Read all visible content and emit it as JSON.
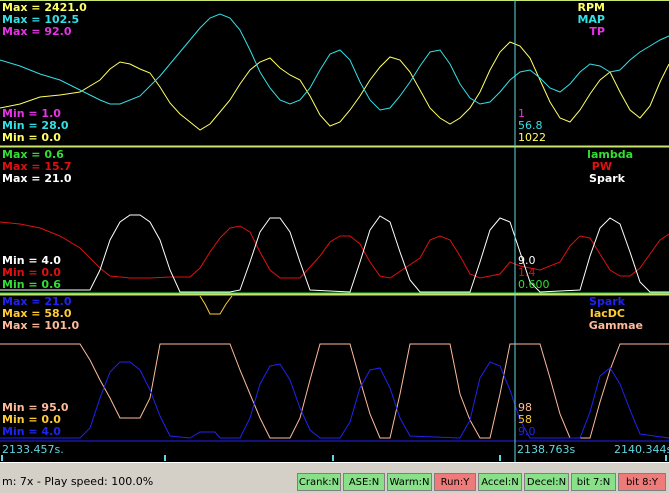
{
  "colors": {
    "rpm": "#ffff66",
    "map": "#33e0e6",
    "tp": "#e633e6",
    "lambda": "#33dd33",
    "pw": "#dd1111",
    "spark": "#ffffff",
    "spark3": "#2222ee",
    "iacdc": "#ffcc33",
    "gammae": "#ffbb99",
    "divider": "#c8e66e",
    "cursor": "#5fd7e0",
    "flag_on": "#88e088",
    "flag_off": "#ee7a7a"
  },
  "panel1": {
    "max_labels": [
      "Max = 2421.0",
      "Max = 102.5",
      "Max = 92.0"
    ],
    "min_labels": [
      "Min = 1.0",
      "Min = 28.0",
      "Min = 0.0"
    ],
    "names": [
      "RPM",
      "MAP",
      "TP"
    ],
    "cursor_values": [
      "1",
      "56.8",
      "1022"
    ]
  },
  "panel2": {
    "max_labels": [
      "Max = 0.6",
      "Max = 15.7",
      "Max = 21.0"
    ],
    "min_labels": [
      "Min = 4.0",
      "Min = 0.0",
      "Min = 0.6"
    ],
    "names": [
      "lambda",
      "PW",
      "Spark"
    ],
    "cursor_values": [
      "9.0",
      "1.4",
      "0.600"
    ]
  },
  "panel3": {
    "max_labels": [
      "Max = 21.0",
      "Max = 58.0",
      "Max = 101.0"
    ],
    "min_labels": [
      "Min = 95.0",
      "Min = 0.0",
      "Min = 4.0"
    ],
    "names": [
      "Spark",
      "IacDC",
      "Gammae"
    ],
    "cursor_values": [
      "98",
      "58",
      "9.0"
    ]
  },
  "timeline": {
    "start": "2133.457s.",
    "cursor": "2138.763s",
    "end": "2140.344s."
  },
  "status": {
    "text": "m: 7x - Play speed: 100.0%",
    "flags": [
      {
        "label": "Crank:N",
        "on": true
      },
      {
        "label": "ASE:N",
        "on": true
      },
      {
        "label": "Warm:N",
        "on": true
      },
      {
        "label": "Run:Y",
        "on": false
      },
      {
        "label": "Accel:N",
        "on": true
      },
      {
        "label": "Decel:N",
        "on": true
      },
      {
        "label": "bit 7:N",
        "on": true
      },
      {
        "label": "bit 8:Y",
        "on": false
      }
    ]
  }
}
